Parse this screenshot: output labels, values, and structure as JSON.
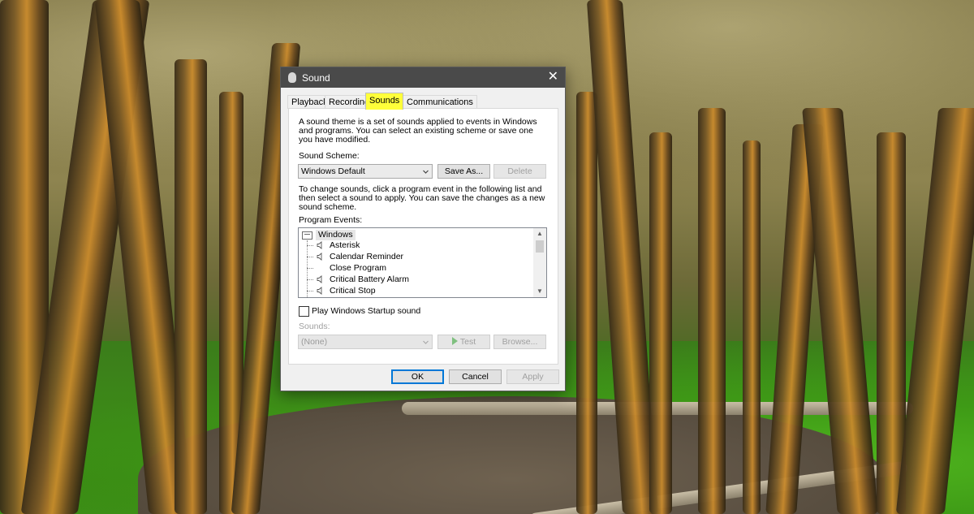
{
  "window": {
    "title": "Sound",
    "close_glyph": "✕"
  },
  "tabs": [
    {
      "label": "Playback"
    },
    {
      "label": "Recording"
    },
    {
      "label": "Sounds"
    },
    {
      "label": "Communications"
    }
  ],
  "sounds_tab": {
    "intro": "A sound theme is a set of sounds applied to events in Windows and programs.  You can select an existing scheme or save one you have modified.",
    "scheme_label": "Sound Scheme:",
    "scheme_value": "Windows Default",
    "save_as_label": "Save As...",
    "delete_label": "Delete",
    "change_text": "To change sounds, click a program event in the following list and then select a sound to apply.  You can save the changes as a new sound scheme.",
    "events_label": "Program Events:",
    "events_root": "Windows",
    "events": [
      {
        "name": "Asterisk",
        "has_sound": true
      },
      {
        "name": "Calendar Reminder",
        "has_sound": true
      },
      {
        "name": "Close Program",
        "has_sound": false
      },
      {
        "name": "Critical Battery Alarm",
        "has_sound": true
      },
      {
        "name": "Critical Stop",
        "has_sound": true
      }
    ],
    "startup_label": "Play Windows Startup sound",
    "startup_checked": false,
    "sounds_label": "Sounds:",
    "sounds_value": "(None)",
    "test_label": "Test",
    "browse_label": "Browse..."
  },
  "footer": {
    "ok_label": "OK",
    "cancel_label": "Cancel",
    "apply_label": "Apply"
  },
  "colors": {
    "highlight_tab": "#ffff3a",
    "title_bar": "#4a4a4a",
    "ok_border": "#0078d7"
  }
}
